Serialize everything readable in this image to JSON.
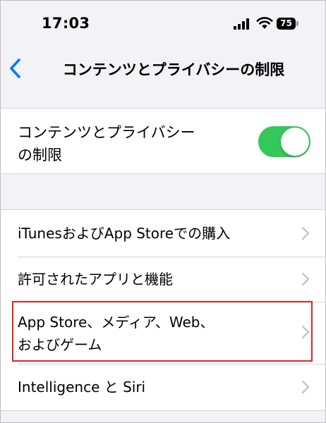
{
  "status_bar": {
    "time": "17:03",
    "battery_level": "75",
    "icons": [
      "signal-icon",
      "wifi-icon",
      "battery-icon"
    ]
  },
  "nav": {
    "back_icon": "chevron-left-icon",
    "title": "コンテンツとプライバシーの制限"
  },
  "toggle_section": {
    "label_line1": "コンテンツとプライバシー",
    "label_line2": "の制限",
    "enabled": true
  },
  "menu": {
    "items": [
      {
        "label": "iTunesおよびApp Storeでの購入"
      },
      {
        "label": "許可されたアプリと機能"
      },
      {
        "label_line1": "App Store、メディア、Web、",
        "label_line2": "およびゲーム",
        "highlighted": true
      },
      {
        "label": "Intelligence と Siri"
      }
    ]
  },
  "colors": {
    "accent": "#007aff",
    "toggle_on": "#34c759",
    "highlight": "#e02424",
    "background": "#f2f2f7"
  }
}
